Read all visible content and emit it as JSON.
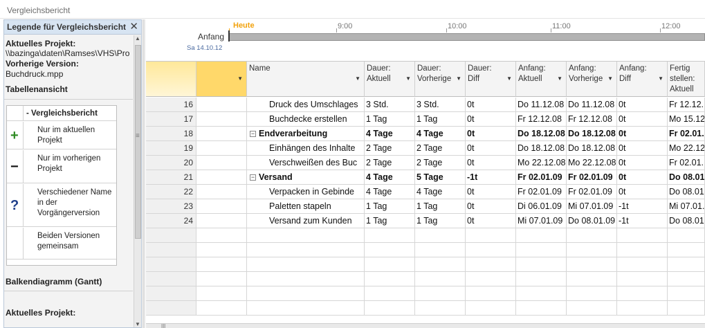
{
  "window": {
    "title": "Vergleichsbericht"
  },
  "legend": {
    "title": "Legende für Vergleichsbericht",
    "close_label": "✕",
    "current_project_label": "Aktuelles Projekt:",
    "current_project_path": "\\\\bazinga\\daten\\Ramses\\VHS\\Pro",
    "previous_version_label": "Vorherige Version:",
    "previous_version_file": "Buchdruck.mpp",
    "table_view_label": "Tabellenansicht",
    "table_title": "- Vergleichsbericht",
    "items": [
      {
        "icon": "plus-icon",
        "glyph": "+",
        "color": "#2e8b24",
        "text": "Nur im aktuellen Projekt"
      },
      {
        "icon": "minus-icon",
        "glyph": "−",
        "color": "#111111",
        "text": "Nur im vorherigen Projekt"
      },
      {
        "icon": "question-icon",
        "glyph": "?",
        "color": "#1f3f8a",
        "text": "Verschiedener Name in der Vorgängerversion"
      },
      {
        "icon": "blank-icon",
        "glyph": "",
        "color": "#111111",
        "text": "Beiden Versionen gemeinsam"
      }
    ],
    "gantt_label": "Balkendiagramm (Gantt)",
    "current_project_label_2": "Aktuelles Projekt:"
  },
  "timeline": {
    "today_label": "Heute",
    "start_label": "Anfang",
    "start_date": "Sa 14.10.12",
    "ticks": [
      "9:00",
      "10:00",
      "11:00",
      "12:00"
    ],
    "today_color": "#f2a20d"
  },
  "grid": {
    "columns": [
      {
        "key": "name",
        "label": "Name"
      },
      {
        "key": "dur_act",
        "label": "Dauer:\nAktuell"
      },
      {
        "key": "dur_prev",
        "label": "Dauer:\nVorherige"
      },
      {
        "key": "dur_diff",
        "label": "Dauer:\nDiff"
      },
      {
        "key": "start_act",
        "label": "Anfang:\nAktuell"
      },
      {
        "key": "start_prev",
        "label": "Anfang:\nVorherige"
      },
      {
        "key": "start_diff",
        "label": "Anfang:\nDiff"
      },
      {
        "key": "finish_act",
        "label": "Fertig\nstellen:\nAktuell"
      }
    ],
    "rows": [
      {
        "id": "16",
        "summary": false,
        "name": "Druck des Umschlages",
        "dur_act": "3 Std.",
        "dur_prev": "3 Std.",
        "dur_diff": "0t",
        "start_act": "Do 11.12.08",
        "start_prev": "Do 11.12.08",
        "start_diff": "0t",
        "finish_act": "Fr 12.12."
      },
      {
        "id": "17",
        "summary": false,
        "name": "Buchdecke erstellen",
        "dur_act": "1 Tag",
        "dur_prev": "1 Tag",
        "dur_diff": "0t",
        "start_act": "Fr 12.12.08",
        "start_prev": "Fr 12.12.08",
        "start_diff": "0t",
        "finish_act": "Mo 15.12."
      },
      {
        "id": "18",
        "summary": true,
        "name": "Endverarbeitung",
        "dur_act": "4 Tage",
        "dur_prev": "4 Tage",
        "dur_diff": "0t",
        "start_act": "Do 18.12.08",
        "start_prev": "Do 18.12.08",
        "start_diff": "0t",
        "finish_act": "Fr 02.01."
      },
      {
        "id": "19",
        "summary": false,
        "name": "Einhängen des Inhalte",
        "dur_act": "2 Tage",
        "dur_prev": "2 Tage",
        "dur_diff": "0t",
        "start_act": "Do 18.12.08",
        "start_prev": "Do 18.12.08",
        "start_diff": "0t",
        "finish_act": "Mo 22.12."
      },
      {
        "id": "20",
        "summary": false,
        "name": "Verschweißen des Buc",
        "dur_act": "2 Tage",
        "dur_prev": "2 Tage",
        "dur_diff": "0t",
        "start_act": "Mo 22.12.08",
        "start_prev": "Mo 22.12.08",
        "start_diff": "0t",
        "finish_act": "Fr 02.01."
      },
      {
        "id": "21",
        "summary": true,
        "name": "Versand",
        "dur_act": "4 Tage",
        "dur_prev": "5 Tage",
        "dur_diff": "-1t",
        "start_act": "Fr 02.01.09",
        "start_prev": "Fr 02.01.09",
        "start_diff": "0t",
        "finish_act": "Do 08.01."
      },
      {
        "id": "22",
        "summary": false,
        "name": "Verpacken in Gebinde",
        "dur_act": "4 Tage",
        "dur_prev": "4 Tage",
        "dur_diff": "0t",
        "start_act": "Fr 02.01.09",
        "start_prev": "Fr 02.01.09",
        "start_diff": "0t",
        "finish_act": "Do 08.01."
      },
      {
        "id": "23",
        "summary": false,
        "name": "Paletten stapeln",
        "dur_act": "1 Tag",
        "dur_prev": "1 Tag",
        "dur_diff": "0t",
        "start_act": "Di 06.01.09",
        "start_prev": "Mi 07.01.09",
        "start_diff": "-1t",
        "finish_act": "Mi 07.01."
      },
      {
        "id": "24",
        "summary": false,
        "name": "Versand zum Kunden",
        "dur_act": "1 Tag",
        "dur_prev": "1 Tag",
        "dur_diff": "0t",
        "start_act": "Mi 07.01.09",
        "start_prev": "Do 08.01.09",
        "start_diff": "-1t",
        "finish_act": "Do 08.01."
      }
    ]
  }
}
